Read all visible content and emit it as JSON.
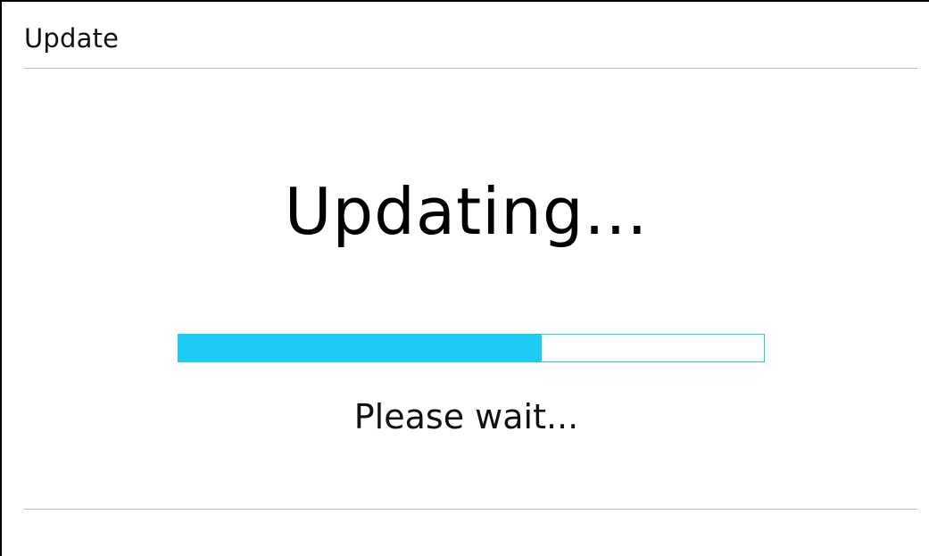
{
  "header": {
    "title": "Update"
  },
  "main": {
    "heading": "Updating...",
    "status_text": "Please wait..."
  },
  "progress": {
    "value": 0.62,
    "fill_color": "#1ecbf5",
    "track_border_color": "#1ecbf5"
  },
  "colors": {
    "divider": "#bcbcbc",
    "frame": "#000000"
  }
}
